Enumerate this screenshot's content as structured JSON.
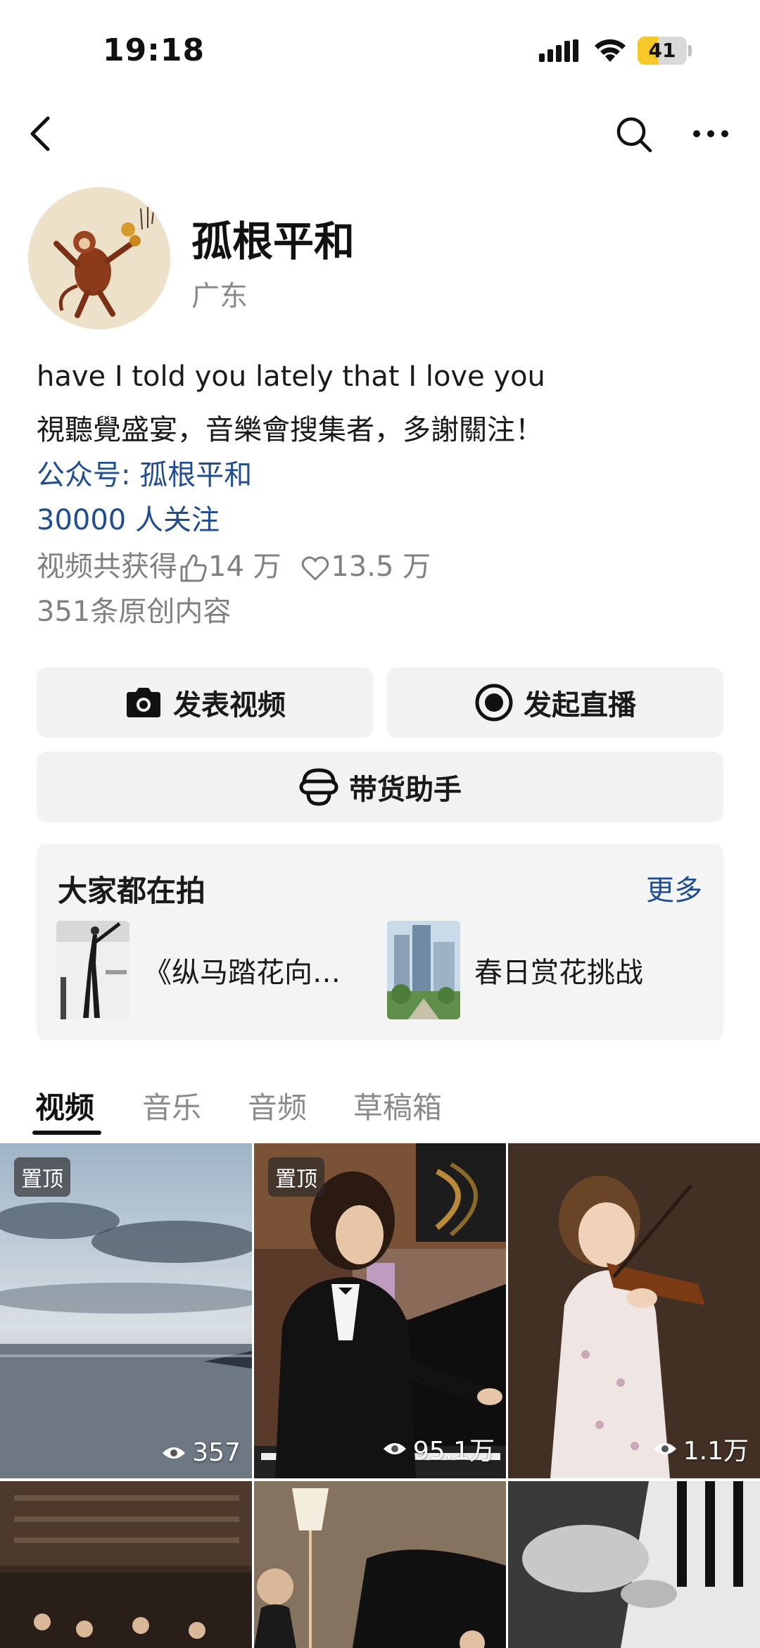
{
  "status_bar": {
    "time": "19:18",
    "battery": "41",
    "battery_level": 0.41
  },
  "nav": {
    "back_icon": "chevron-left-icon",
    "search_icon": "search-icon",
    "more_icon": "more-icon"
  },
  "profile": {
    "name": "孤根平和",
    "region": "广东",
    "bio_line1": "have I told you lately that I love you",
    "bio_line2": "視聽覺盛宴，音樂會搜集者，多謝關注！",
    "official_account": "公众号: 孤根平和",
    "followers": "30000 人关注",
    "stats_prefix": "视频共获得",
    "likes": "14 万",
    "hearts": "13.5 万",
    "original_count": "351条原创内容"
  },
  "actions": {
    "post_video": "发表视频",
    "start_live": "发起直播",
    "shopping_assistant": "带货助手"
  },
  "trending": {
    "title": "大家都在拍",
    "more": "更多",
    "topics": [
      {
        "label": "《纵马踏花向…"
      },
      {
        "label": "春日赏花挑战"
      }
    ]
  },
  "tabs": [
    {
      "label": "视频",
      "active": true
    },
    {
      "label": "音乐",
      "active": false
    },
    {
      "label": "音频",
      "active": false
    },
    {
      "label": "草稿箱",
      "active": false
    }
  ],
  "videos": [
    {
      "pinned": "置顶",
      "views": "357"
    },
    {
      "pinned": "置顶",
      "views": "95.1万"
    },
    {
      "pinned": "",
      "views": "1.1万"
    },
    {
      "pinned": "",
      "views": ""
    },
    {
      "pinned": "",
      "views": ""
    },
    {
      "pinned": "",
      "views": ""
    }
  ]
}
